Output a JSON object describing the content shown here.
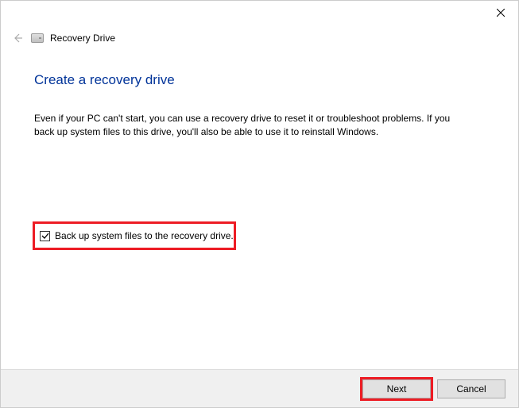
{
  "window": {
    "title": "Recovery Drive"
  },
  "page": {
    "heading": "Create a recovery drive",
    "description": "Even if your PC can't start, you can use a recovery drive to reset it or troubleshoot problems. If you back up system files to this drive, you'll also be able to use it to reinstall Windows."
  },
  "checkbox": {
    "label": "Back up system files to the recovery drive.",
    "checked": true
  },
  "buttons": {
    "next": "Next",
    "cancel": "Cancel"
  }
}
